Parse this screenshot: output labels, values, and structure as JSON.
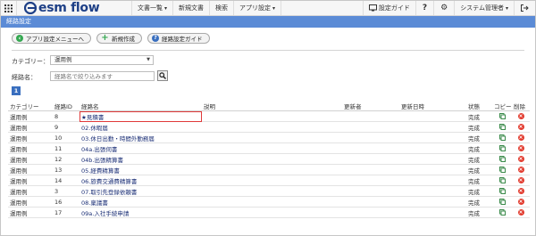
{
  "app": {
    "name": "esm flow"
  },
  "nav": {
    "items": [
      "文書一覧",
      "新規文書",
      "検索",
      "アプリ設定"
    ],
    "dropdown_flags": [
      true,
      false,
      false,
      true
    ],
    "settings_guide": "設定ガイド",
    "help": "?",
    "user": "システム管理者"
  },
  "page": {
    "title": "経路設定"
  },
  "toolbar": {
    "app_settings_menu": "アプリ設定メニューへ",
    "new": "新規作成",
    "route_guide": "経路設定ガイド"
  },
  "filters": {
    "category_label": "カテゴリー：",
    "category_value": "運用例",
    "route_name_label": "経路名：",
    "route_name_placeholder": "経路名で絞り込みます"
  },
  "pagination": {
    "current": "1"
  },
  "table": {
    "headers": [
      "カテゴリー",
      "経路ID",
      "経路名",
      "説明",
      "更新者",
      "更新日時",
      "状態",
      "コピー",
      "削除"
    ],
    "rows": [
      {
        "category": "運用例",
        "id": "8",
        "name": "★見積書",
        "status": "完成"
      },
      {
        "category": "運用例",
        "id": "9",
        "name": "02.休暇届",
        "status": "完成"
      },
      {
        "category": "運用例",
        "id": "10",
        "name": "03.休日出勤・時間外勤務届",
        "status": "完成"
      },
      {
        "category": "運用例",
        "id": "11",
        "name": "04a.出張伺書",
        "status": "完成"
      },
      {
        "category": "運用例",
        "id": "12",
        "name": "04b.出張精算書",
        "status": "完成"
      },
      {
        "category": "運用例",
        "id": "13",
        "name": "05.経費精算書",
        "status": "完成"
      },
      {
        "category": "運用例",
        "id": "14",
        "name": "06.旅費交通費精算書",
        "status": "完成"
      },
      {
        "category": "運用例",
        "id": "3",
        "name": "07.取引先登録依頼書",
        "status": "完成"
      },
      {
        "category": "運用例",
        "id": "16",
        "name": "08.稟議書",
        "status": "完成"
      },
      {
        "category": "運用例",
        "id": "17",
        "name": "09a.入社手続申請",
        "status": "完成"
      }
    ]
  },
  "colors": {
    "title_bar": "#5b8bd6",
    "brand": "#1d3f86",
    "highlight": "#e03a3a",
    "delete": "#e23b2e",
    "copy": "#3a8a4a"
  }
}
